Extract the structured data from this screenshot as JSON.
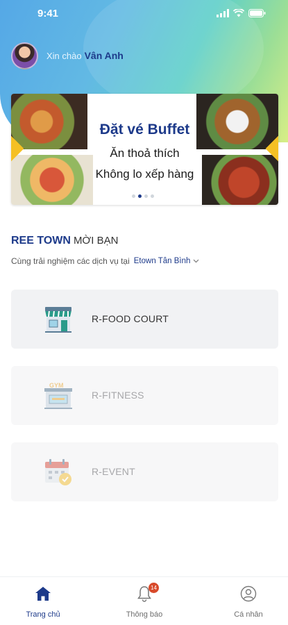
{
  "status_bar": {
    "time": "9:41"
  },
  "greeting": {
    "label": "Xin chào",
    "name": "Vân Anh"
  },
  "banner": {
    "title": "Đặt vé Buffet",
    "line1": "Ăn thoả thích",
    "line2": "Không lo xếp hàng",
    "dot_count": 4,
    "active_dot": 1
  },
  "section": {
    "title_strong": "REE TOWN",
    "title_rest": "MỜI BẠN",
    "subtitle": "Cùng trải nghiệm các dịch vụ tại",
    "location": "Etown Tân Bình"
  },
  "services": [
    {
      "label": "R-FOOD COURT",
      "icon": "store-icon",
      "enabled": true
    },
    {
      "label": "R-FITNESS",
      "icon": "gym-icon",
      "enabled": false
    },
    {
      "label": "R-EVENT",
      "icon": "calendar-check-icon",
      "enabled": false
    }
  ],
  "tabbar": {
    "home": "Trang chủ",
    "notifications": "Thông báo",
    "notification_count": "14",
    "profile": "Cá nhân"
  },
  "colors": {
    "brand": "#1d3a8a",
    "badge": "#d84a2b",
    "accent_yellow": "#f5c024"
  }
}
